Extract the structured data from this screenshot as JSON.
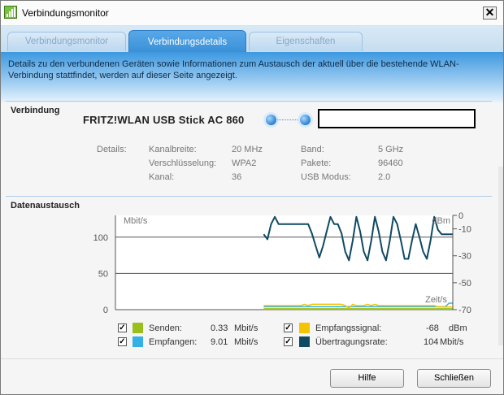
{
  "window": {
    "title": "Verbindungsmonitor",
    "close_glyph": "✕"
  },
  "tabs": [
    {
      "label": "Verbindungsmonitor",
      "active": false
    },
    {
      "label": "Verbindungsdetails",
      "active": true
    },
    {
      "label": "Eigenschaften",
      "active": false
    }
  ],
  "description": "Details zu den verbundenen Geräten sowie Informationen zum Austausch der aktuell über die bestehende WLAN-Verbindung stattfindet, werden auf dieser Seite angezeigt.",
  "connection": {
    "section_title": "Verbindung",
    "device_name": "FRITZ!WLAN USB Stick AC 860",
    "details_label": "Details:",
    "details": [
      {
        "label": "Kanalbreite:",
        "value": "20 MHz"
      },
      {
        "label": "Verschlüsselung:",
        "value": "WPA2"
      },
      {
        "label": "Kanal:",
        "value": "36"
      },
      {
        "label": "Band:",
        "value": "5 GHz"
      },
      {
        "label": "Pakete:",
        "value": "96460"
      },
      {
        "label": "USB Modus:",
        "value": "2.0"
      }
    ]
  },
  "exchange": {
    "section_title": "Datenaustausch",
    "legend": [
      {
        "label": "Senden:",
        "value": "0.33",
        "unit": "Mbit/s",
        "checked": true,
        "color": "#99c01a"
      },
      {
        "label": "Empfangen:",
        "value": "9.01",
        "unit": "Mbit/s",
        "checked": true,
        "color": "#33b1e6"
      },
      {
        "label": "Empfangssignal:",
        "value": "-68",
        "unit": "dBm",
        "checked": true,
        "color": "#f5c400"
      },
      {
        "label": "Übertragungsrate:",
        "value": "104",
        "unit": "Mbit/s",
        "checked": true,
        "color": "#0f4a63"
      }
    ]
  },
  "chart_data": {
    "type": "line",
    "ylabel": "Mbit/s",
    "ylabel_right": "dBm",
    "xlabel": "Zeit/s",
    "left_ticks": [
      "100",
      "50",
      "0"
    ],
    "right_ticks": [
      "0",
      "-10",
      "-30",
      "-50",
      "-70"
    ],
    "ylim": [
      0,
      130
    ],
    "ylim_right": [
      -70,
      0
    ],
    "grid": true,
    "series": [
      {
        "name": "Übertragungsrate",
        "axis": "left",
        "color": "#0f4a63",
        "values": [
          null,
          null,
          null,
          null,
          null,
          null,
          null,
          null,
          null,
          null,
          null,
          null,
          null,
          null,
          null,
          null,
          null,
          null,
          null,
          null,
          null,
          null,
          null,
          null,
          null,
          null,
          null,
          null,
          null,
          null,
          null,
          null,
          null,
          null,
          null,
          null,
          null,
          null,
          null,
          null,
          104,
          97,
          118,
          128,
          118,
          118,
          118,
          118,
          118,
          118,
          118,
          118,
          118,
          105,
          88,
          72,
          88,
          108,
          128,
          118,
          118,
          105,
          80,
          68,
          95,
          128,
          108,
          80,
          68,
          95,
          128,
          108,
          80,
          68,
          95,
          128,
          118,
          95,
          70,
          70,
          95,
          118,
          100,
          80,
          70,
          95,
          128,
          110,
          104,
          104,
          104,
          104
        ]
      },
      {
        "name": "Senden",
        "axis": "left",
        "color": "#99c01a",
        "values": [
          null,
          null,
          null,
          null,
          null,
          null,
          null,
          null,
          null,
          null,
          null,
          null,
          null,
          null,
          null,
          null,
          null,
          null,
          null,
          null,
          null,
          null,
          null,
          null,
          null,
          null,
          null,
          null,
          null,
          null,
          null,
          null,
          null,
          null,
          null,
          null,
          null,
          null,
          null,
          null,
          1,
          1,
          1,
          1,
          1,
          1,
          1,
          1,
          1,
          1,
          1,
          1,
          1,
          1,
          1,
          1,
          1,
          1,
          1,
          1,
          1,
          1,
          1,
          1,
          1,
          1,
          1,
          1,
          1,
          1,
          1,
          1,
          1,
          1,
          1,
          1,
          1,
          1,
          1,
          1,
          1,
          1,
          1,
          1,
          1,
          1,
          1,
          1,
          1,
          1,
          1,
          1
        ]
      },
      {
        "name": "Empfangen",
        "axis": "left",
        "color": "#33b1e6",
        "values": [
          null,
          null,
          null,
          null,
          null,
          null,
          null,
          null,
          null,
          null,
          null,
          null,
          null,
          null,
          null,
          null,
          null,
          null,
          null,
          null,
          null,
          null,
          null,
          null,
          null,
          null,
          null,
          null,
          null,
          null,
          null,
          null,
          null,
          null,
          null,
          null,
          null,
          null,
          null,
          null,
          4,
          4,
          4,
          4,
          4,
          4,
          4,
          4,
          4,
          4,
          4,
          4,
          4,
          4,
          4,
          4,
          4,
          4,
          4,
          4,
          4,
          4,
          4,
          4,
          4,
          4,
          4,
          4,
          4,
          4,
          4,
          4,
          4,
          4,
          4,
          4,
          4,
          4,
          4,
          4,
          4,
          4,
          4,
          4,
          4,
          4,
          4,
          4,
          4,
          4,
          9,
          9
        ]
      },
      {
        "name": "Empfangssignal",
        "axis": "right",
        "color": "#f5c400",
        "values": [
          null,
          null,
          null,
          null,
          null,
          null,
          null,
          null,
          null,
          null,
          null,
          null,
          null,
          null,
          null,
          null,
          null,
          null,
          null,
          null,
          null,
          null,
          null,
          null,
          null,
          null,
          null,
          null,
          null,
          null,
          null,
          null,
          null,
          null,
          null,
          null,
          null,
          null,
          null,
          null,
          -67,
          -67,
          -67,
          -67,
          -67,
          -67,
          -67,
          -67,
          -67,
          -67,
          -67,
          -66,
          -67,
          -66,
          -66,
          -66,
          -66,
          -66,
          -66,
          -66,
          -66,
          -66,
          -67,
          -69,
          -66,
          -67,
          -67,
          -67,
          -66,
          -67,
          -66,
          -67,
          -67,
          -67,
          -67,
          -67,
          -67,
          -67,
          -67,
          -67,
          -67,
          -67,
          -67,
          -67,
          -67,
          -67,
          -67,
          -68,
          -68,
          -68,
          -68,
          -68
        ]
      }
    ]
  },
  "buttons": {
    "help": "Hilfe",
    "close": "Schließen"
  }
}
